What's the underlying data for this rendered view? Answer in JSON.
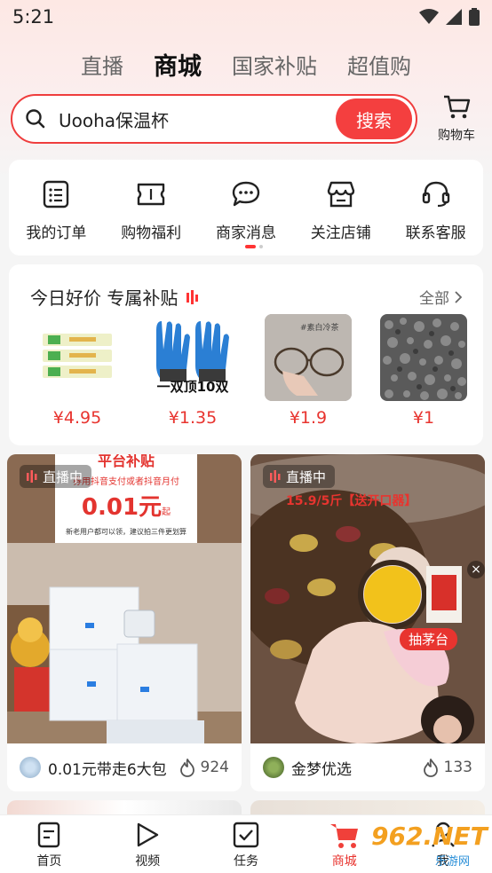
{
  "status_bar": {
    "time": "5:21"
  },
  "tabs": [
    {
      "label": "直播",
      "active": false
    },
    {
      "label": "商城",
      "active": true
    },
    {
      "label": "国家补贴",
      "active": false
    },
    {
      "label": "超值购",
      "active": false
    }
  ],
  "search": {
    "query": "Uooha保温杯",
    "button": "搜索"
  },
  "cart": {
    "label": "购物车"
  },
  "quick_menu": [
    {
      "label": "我的订单",
      "icon": "order-list-icon"
    },
    {
      "label": "购物福利",
      "icon": "ticket-icon"
    },
    {
      "label": "商家消息",
      "icon": "chat-bubble-icon"
    },
    {
      "label": "关注店铺",
      "icon": "store-icon"
    },
    {
      "label": "联系客服",
      "icon": "headset-icon"
    }
  ],
  "deals": {
    "title": "今日好价 专属补贴",
    "all_label": "全部",
    "products": [
      {
        "price": "¥4.95",
        "img_text": ""
      },
      {
        "price": "¥1.35",
        "img_text": "一双顶10双"
      },
      {
        "price": "¥1.9",
        "img_text": "#素白冷茶"
      },
      {
        "price": "¥1",
        "img_text": ""
      }
    ]
  },
  "feed": [
    {
      "live": "直播中",
      "banner_top": "平台补贴",
      "banner_sub": "券用抖音支付或者抖音月付",
      "banner_price": "0.01元",
      "banner_price_suffix": "起",
      "banner_note": "新老用户都可以领，建议拍三件更划算",
      "title": "0.01元带走6大包",
      "hot": "924"
    },
    {
      "live": "直播中",
      "promo": "15.9/5斤【送开口器】",
      "tag": "抽茅台",
      "title": "金梦优选",
      "hot": "133"
    }
  ],
  "bottom_nav": [
    {
      "label": "首页",
      "icon": "home-doc-icon",
      "active": false
    },
    {
      "label": "视频",
      "icon": "play-icon",
      "active": false
    },
    {
      "label": "任务",
      "icon": "task-check-icon",
      "active": false
    },
    {
      "label": "商城",
      "icon": "mall-cart-icon",
      "active": true
    },
    {
      "label": "我",
      "icon": "person-icon",
      "active": false
    }
  ],
  "watermark": {
    "text": "962.NET",
    "sub": "乐游网"
  },
  "colors": {
    "accent": "#f43f3f",
    "price": "#e8342f"
  }
}
